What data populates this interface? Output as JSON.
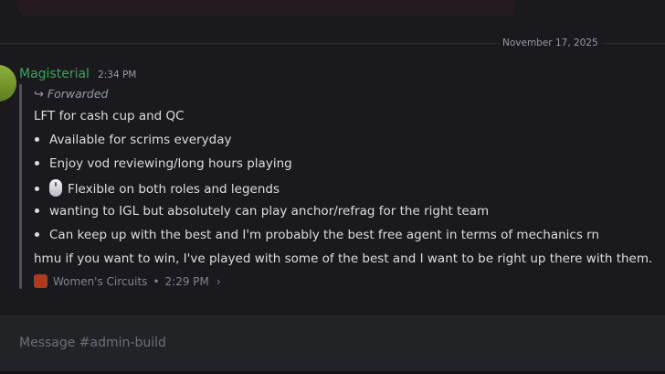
{
  "date_divider": "November 17, 2025",
  "message": {
    "author": "Magisterial",
    "time": "2:34 PM",
    "forwarded_label": "Forwarded",
    "lines": {
      "intro": "LFT for cash cup and QC",
      "b1": "Available for scrims everyday",
      "b2": "Enjoy vod reviewing/long hours playing",
      "b3": "Flexible on both roles and legends",
      "b4": "wanting to IGL but absolutely can play anchor/refrag for the right team",
      "b5": "Can keep up with the best and I'm probably the best free agent in terms of mechanics rn",
      "outro": "hmu if you want to win, I've played with some of the best and I want to be right up there with them."
    },
    "source_server": "Women's Circuits",
    "source_time": "2:29 PM",
    "emoji_b3": "computer-mouse"
  },
  "composer": {
    "placeholder": "Message #admin-build"
  },
  "colors": {
    "author": "#3ba55c",
    "background": "#1a1a1e",
    "server_icon": "#b13a1e"
  }
}
